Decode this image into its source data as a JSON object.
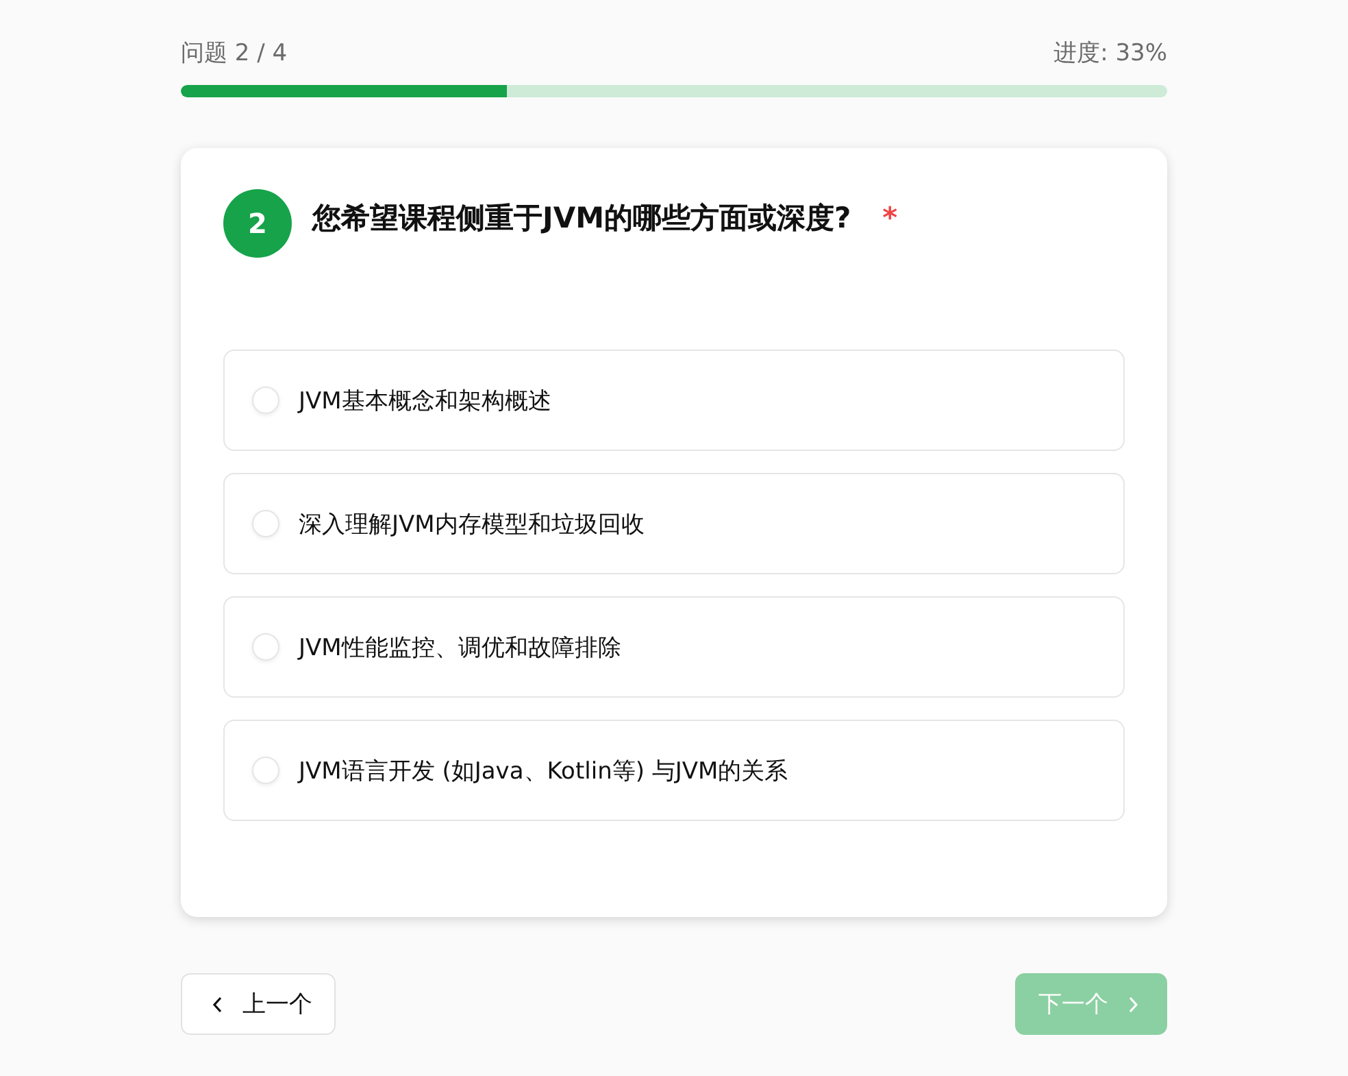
{
  "progress": {
    "counter": "问题 2 / 4",
    "reading": "进度: 33%",
    "level": 0.33
  },
  "question": {
    "number": "2",
    "title": "您希望课程侧重于JVM的哪些方面或深度?",
    "required_mark": "*",
    "options": [
      {
        "label": "JVM基本概念和架构概述",
        "selected": false
      },
      {
        "label": "深入理解JVM内存模型和垃圾回收",
        "selected": false
      },
      {
        "label": "JVM性能监控、调优和故障排除",
        "selected": false
      },
      {
        "label": "JVM语言开发 (如Java、Kotlin等) 与JVM的关系",
        "selected": false
      }
    ]
  },
  "nav": {
    "prev": {
      "label": "上一个",
      "disabled": false
    },
    "next": {
      "label": "下一个",
      "disabled": true
    }
  }
}
